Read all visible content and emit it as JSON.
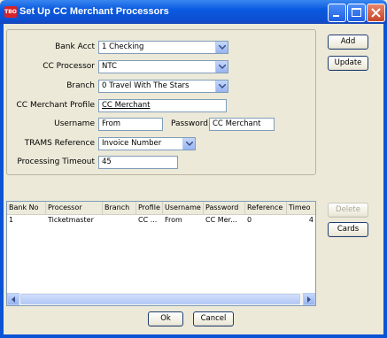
{
  "window": {
    "title": "Set Up CC Merchant Processors",
    "app_icon_text": "TBO"
  },
  "form": {
    "bank_acct": {
      "label": "Bank Acct",
      "value": "1 Checking"
    },
    "cc_processor": {
      "label": "CC Processor",
      "value": "NTC"
    },
    "branch": {
      "label": "Branch",
      "value": "0  Travel With The Stars"
    },
    "cc_merchant_profile": {
      "label": "CC Merchant Profile",
      "value": "CC Merchant"
    },
    "username": {
      "label": "Username",
      "value": "From"
    },
    "password": {
      "label": "Password",
      "value": "CC Merchant"
    },
    "trams_reference": {
      "label": "TRAMS Reference",
      "value": "Invoice Number"
    },
    "processing_timeout": {
      "label": "Processing Timeout",
      "value": "45"
    }
  },
  "buttons": {
    "add": "Add",
    "update": "Update",
    "delete": "Delete",
    "cards": "Cards",
    "ok": "Ok",
    "cancel": "Cancel"
  },
  "grid": {
    "columns": [
      "Bank No",
      "Processor",
      "Branch",
      "Profile",
      "Username",
      "Password",
      "Reference",
      "Timeo"
    ],
    "rows": [
      [
        "1",
        "Ticketmaster",
        "",
        "CC ...",
        "From",
        "CC Mer...",
        "0",
        "4"
      ]
    ]
  }
}
